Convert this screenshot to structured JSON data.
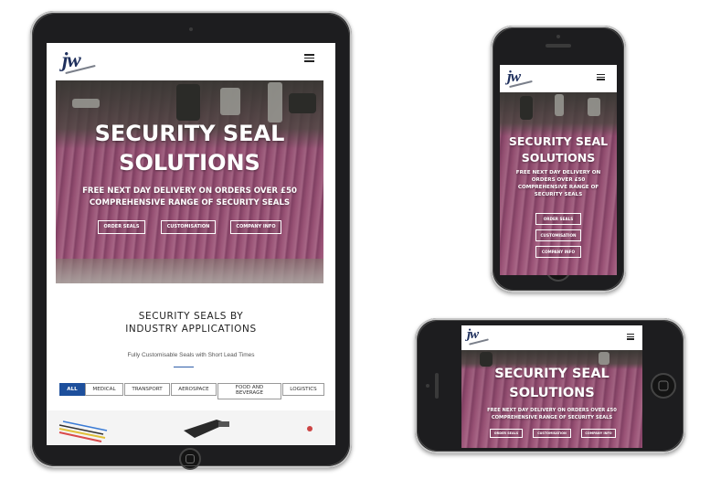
{
  "logo": {
    "text": "jw"
  },
  "hero": {
    "title_line1": "SECURITY SEAL",
    "title_line2": "SOLUTIONS",
    "subtitle_line1": "FREE NEXT DAY DELIVERY ON ORDERS OVER £50",
    "subtitle_line2": "COMPREHENSIVE RANGE OF SECURITY SEALS",
    "phone_subtitle_line1": "FREE NEXT DAY DELIVERY ON",
    "phone_subtitle_line2": "ORDERS OVER £50",
    "phone_subtitle_line3": "COMPREHENSIVE RANGE OF",
    "phone_subtitle_line4": "SECURITY SEALS",
    "buttons": {
      "order": "ORDER SEALS",
      "custom": "CUSTOMISATION",
      "company": "COMPANY INFO"
    }
  },
  "section": {
    "title_line1": "SECURITY SEALS BY",
    "title_line2": "INDUSTRY APPLICATIONS",
    "subtitle": "Fully Customisable Seals with Short Lead Times"
  },
  "filters": {
    "all": "ALL",
    "medical": "MEDICAL",
    "transport": "TRANSPORT",
    "aerospace": "AEROSPACE",
    "food_line1": "FOOD AND",
    "food_line2": "BEVERAGE",
    "logistics": "LOGISTICS"
  },
  "colors": {
    "accent_blue": "#1d4f9c",
    "hero_pink": "#c66a98",
    "device_black": "#1d1d1f"
  },
  "icons": [
    "hamburger-menu-icon",
    "home-button-icon",
    "camera-icon"
  ]
}
